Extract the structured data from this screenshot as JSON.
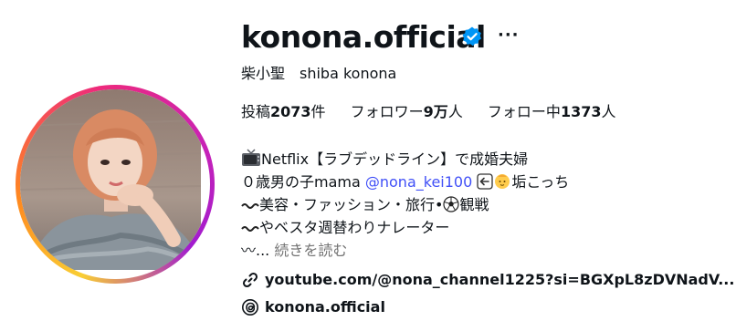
{
  "profile": {
    "username": "konona.official",
    "more_label": "···",
    "full_name": "柴小聖　shiba konona",
    "icons": {
      "verified": "verified-badge-icon",
      "more": "more-options-icon",
      "link": "link-icon",
      "threads": "threads-icon"
    },
    "accent_color": "#0095f6",
    "mention_color": "#4150f7"
  },
  "stats": {
    "posts_label": "投稿",
    "posts_value": "2073",
    "posts_unit": "件",
    "followers_label": "フォロワー",
    "followers_value": "9万",
    "followers_unit": "人",
    "following_label": "フォロー中",
    "following_value": "1373",
    "following_unit": "人"
  },
  "bio": {
    "line1": "Netflix【ラブデッドライン】で成婚夫婦",
    "line2_prefix": "０歳男の子mama ",
    "line2_mention": "@nona_kei100",
    "line2_suffix": "垢こっち",
    "line3_a": "美容・ファッション・旅行•",
    "line3_b": "観戦",
    "line4": "やベスタ週替わりナレーター",
    "line5_prefix": "〰... ",
    "read_more": "続きを読む"
  },
  "links": {
    "url": "youtube.com/@nona_channel1225?si=BGXpL8zDVNadV...",
    "threads_handle": "konona.official"
  }
}
